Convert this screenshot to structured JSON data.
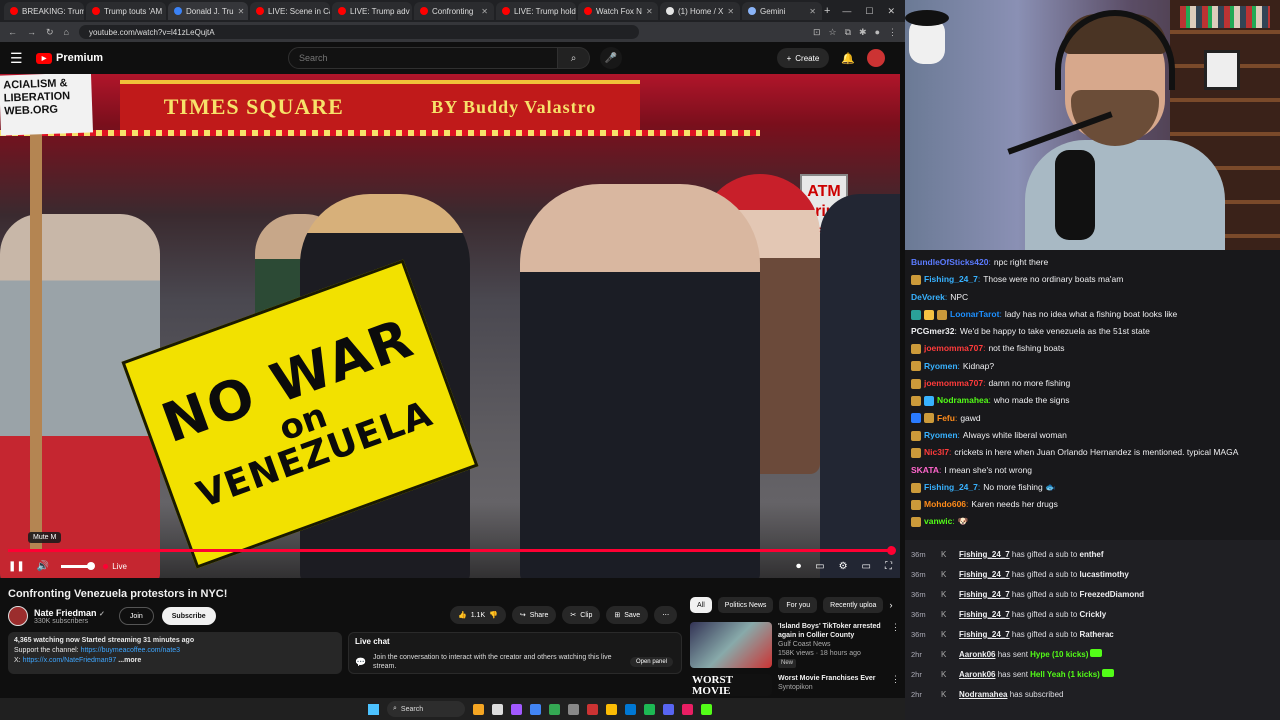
{
  "browser": {
    "tabs": [
      {
        "label": "BREAKING: Trum",
        "color": "#ff0000"
      },
      {
        "label": "Trump touts 'AM",
        "color": "#ff0000"
      },
      {
        "label": "Donald J. Tru",
        "color": "#3b82f6",
        "active": true
      },
      {
        "label": "LIVE: Scene in Ca",
        "color": "#ff0000"
      },
      {
        "label": "LIVE: Trump adv",
        "color": "#ff0000"
      },
      {
        "label": "Confronting",
        "color": "#ff0000"
      },
      {
        "label": "LIVE: Trump hold",
        "color": "#ff0000"
      },
      {
        "label": "Watch Fox N",
        "color": "#ff0000"
      },
      {
        "label": "(1) Home / X",
        "color": "#e5e5e5"
      },
      {
        "label": "Gemini",
        "color": "#8ab4f8"
      }
    ],
    "url": "youtube.com/watch?v=l41zLeQujtA"
  },
  "yt_header": {
    "logo_text": "Premium",
    "search_placeholder": "Search",
    "create_label": "Create"
  },
  "video": {
    "sign_top_left": "TIMES SQUARE",
    "sign_top_right": "BY Buddy Valastro",
    "banner_left": "ACIALISM & LIBERATION WEB.ORG",
    "atm_text": "ATM Drink Cand",
    "protest_line1": "NO WAR",
    "protest_line2": "on",
    "protest_line3": "VENEZUELA",
    "tooltip": "Mute  M",
    "live_label": "Live"
  },
  "below_video": {
    "title": "Confronting Venezuela protestors in NYC!",
    "channel_name": "Nate Friedman",
    "verified_mark": "✓",
    "subscribers": "330K subscribers",
    "join_label": "Join",
    "subscribe_label": "Subscribe",
    "like_count": "1.1K",
    "share_label": "Share",
    "clip_label": "Clip",
    "save_label": "Save",
    "desc_stats": "4,365 watching now  Started streaming 31 minutes ago",
    "desc_support": "Support the channel: ",
    "desc_support_link": "https://buymeacoffee.com/nate3",
    "desc_x_prefix": "X: ",
    "desc_x_link": "https://x.com/NateFriedman97",
    "desc_more": " ...more",
    "livechat_title": "Live chat",
    "livechat_msg": "Join the conversation to interact with the creator and others watching this live stream.",
    "open_panel": "Open panel"
  },
  "chips": [
    "All",
    "Politics News",
    "For you",
    "Recently uploa"
  ],
  "recommendations": [
    {
      "title": "'Island Boys' TikToker arrested again in Collier County",
      "channel": "Gulf Coast News",
      "meta": "158K views · 18 hours ago",
      "badge": "New"
    },
    {
      "title": "Worst Movie Franchises Ever",
      "channel": "Syntopikon",
      "thumb_text": "WORST MOVIE"
    }
  ],
  "chat": [
    {
      "user": "BundleOfSticks420",
      "color": "#5b7bff",
      "text": "npc right there",
      "badges": []
    },
    {
      "user": "Fishing_24_7",
      "color": "#38b2ff",
      "text": "Those were no ordinary boats ma'am",
      "badges": [
        "#cc9a3a"
      ]
    },
    {
      "user": "DeVorek",
      "color": "#38b2ff",
      "text": "NPC",
      "badges": []
    },
    {
      "user": "LoonarTarot",
      "color": "#1e90ff",
      "text": "lady has no idea what a fishing boat looks like",
      "badges": [
        "#2aa198",
        "#f5c242",
        "#cc9a3a"
      ]
    },
    {
      "user": "PCGmer32",
      "color": "#efeff1",
      "text": "We'd be happy to take venezuela as the 51st state",
      "badges": []
    },
    {
      "user": "joemomma707",
      "color": "#ff3b3b",
      "text": "not the fishing boats",
      "badges": [
        "#cc9a3a"
      ]
    },
    {
      "user": "Ryomen",
      "color": "#38b2ff",
      "text": "Kidnap?",
      "badges": [
        "#cc9a3a"
      ]
    },
    {
      "user": "joemomma707",
      "color": "#ff3b3b",
      "text": "damn no more fishing",
      "badges": [
        "#cc9a3a"
      ]
    },
    {
      "user": "Nodramahea",
      "color": "#53fc18",
      "text": "who made the signs",
      "badges": [
        "#cc9a3a",
        "#38b2ff"
      ]
    },
    {
      "user": "Fefu",
      "color": "#ff8c1a",
      "text": "gawd",
      "badges": [
        "#2a7bff",
        "#cc9a3a"
      ]
    },
    {
      "user": "Ryomen",
      "color": "#38b2ff",
      "text": "Always white liberal woman",
      "badges": [
        "#cc9a3a"
      ]
    },
    {
      "user": "Nic3l7",
      "color": "#ff3b3b",
      "text": "crickets in here when Juan Orlando Hernandez is mentioned. typical MAGA",
      "badges": [
        "#cc9a3a"
      ]
    },
    {
      "user": "SKATA",
      "color": "#ff66cc",
      "text": "I mean she's not wrong",
      "badges": []
    },
    {
      "user": "Fishing_24_7",
      "color": "#38b2ff",
      "text": "No more fishing 🐟",
      "badges": [
        "#cc9a3a"
      ]
    },
    {
      "user": "Mohdo606",
      "color": "#ff8c1a",
      "text": "Karen needs her drugs",
      "badges": [
        "#cc9a3a"
      ]
    },
    {
      "user": "vanwic",
      "color": "#53fc18",
      "text": "🐶",
      "badges": [
        "#cc9a3a"
      ]
    }
  ],
  "events": [
    {
      "time": "36m",
      "user": "Fishing_24_7",
      "action": " has gifted a sub to ",
      "target": "enthef",
      "kicks": ""
    },
    {
      "time": "36m",
      "user": "Fishing_24_7",
      "action": " has gifted a sub to ",
      "target": "lucastimothy",
      "kicks": ""
    },
    {
      "time": "36m",
      "user": "Fishing_24_7",
      "action": " has gifted a sub to ",
      "target": "FreezedDiamond",
      "kicks": ""
    },
    {
      "time": "36m",
      "user": "Fishing_24_7",
      "action": " has gifted a sub to ",
      "target": "Crickly",
      "kicks": ""
    },
    {
      "time": "36m",
      "user": "Fishing_24_7",
      "action": " has gifted a sub to ",
      "target": "Ratherac",
      "kicks": ""
    },
    {
      "time": "2hr",
      "user": "Aaronk06",
      "action": " has sent ",
      "target": "",
      "kicks": "Hype (10 kicks)"
    },
    {
      "time": "2hr",
      "user": "Aaronk06",
      "action": " has sent ",
      "target": "",
      "kicks": "Hell Yeah (1 kicks)"
    },
    {
      "time": "2hr",
      "user": "Nodramahea",
      "action": " has subscribed",
      "target": "",
      "kicks": ""
    }
  ],
  "taskbar": {
    "search_label": "Search"
  }
}
